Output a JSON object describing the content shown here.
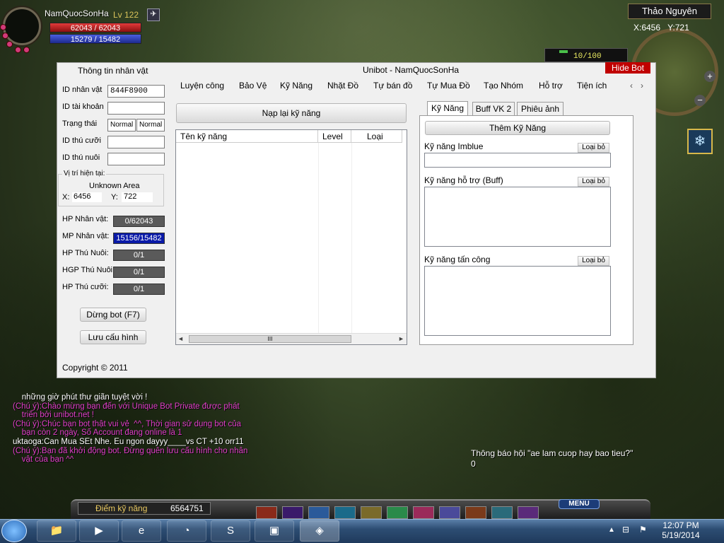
{
  "game": {
    "player_name": "NamQuocSonHa",
    "player_level": "Lv 122",
    "hp_text": "62043 / 62043",
    "mp_text": "15279 / 15482",
    "map_name": "Thảo Nguyên",
    "map_x": "X:6456",
    "map_y": "Y:721",
    "xp_text": "10/100",
    "skill_points_label": "Điểm kỹ năng",
    "skill_points_value": "6564751",
    "menu_label": "MENU",
    "notice_line1": "Thông báo hội \"ae lam cuop hay bao tieu?\"",
    "notice_line2": "0"
  },
  "chat": [
    {
      "text": "    những giờ phút thư giãn tuyệt vời !",
      "color": "#ffffff"
    },
    {
      "text": "(Chú ý):Chào mừng bạn đến với Unique Bot Private được phát",
      "color": "#e040c8"
    },
    {
      "text": "    triển bởi unibot.net !",
      "color": "#e040c8"
    },
    {
      "text": "(Chú ý):Chúc bạn bot thật vui vẻ  ^^, Thời gian sử dụng bot của",
      "color": "#e040c8"
    },
    {
      "text": "    bạn còn 2 ngày, Số Account đang online là 1",
      "color": "#e040c8"
    },
    {
      "text": "uktaoga:Can Mua SEt Nhe. Eu ngon dayyy____vs CT +10 orr11",
      "color": "#ffffff"
    },
    {
      "text": "(Chú ý):Bạn đã khởi động bot. Đừng quên lưu cấu hình cho nhân",
      "color": "#e040c8"
    },
    {
      "text": "    vật của bạn ^^",
      "color": "#e040c8"
    }
  ],
  "bot": {
    "window_title": "Unibot - NamQuocSonHa",
    "hide_button": "Hide Bot",
    "left_title": "Thông tin nhân vật",
    "fields": {
      "char_id_label": "ID nhân vật",
      "char_id_value": "844F8900",
      "account_id_label": "ID tài khoản",
      "account_id_value": "",
      "status_label": "Trạng thái",
      "status_value1": "Normal",
      "status_value2": "Normal",
      "mount_id_label": "ID thú cưỡi",
      "mount_id_value": "",
      "pet_id_label": "ID thú nuôi",
      "pet_id_value": ""
    },
    "position": {
      "legend": "Vị trí hiện tại:",
      "area": "Unknown Area",
      "x_label": "X:",
      "x_value": "6456",
      "y_label": "Y:",
      "y_value": "722"
    },
    "stats": [
      {
        "label": "HP Nhân vật:",
        "value": "0/62043",
        "color": "#5a5a5a"
      },
      {
        "label": "MP Nhân vật:",
        "value": "15156/15482",
        "color": "#0a1aa8"
      },
      {
        "label": "HP Thú Nuôi:",
        "value": "0/1",
        "color": "#5a5a5a"
      },
      {
        "label": "HGP Thú Nuôi:",
        "value": "0/1",
        "color": "#5a5a5a"
      },
      {
        "label": "HP Thú cưỡi:",
        "value": "0/1",
        "color": "#5a5a5a"
      }
    ],
    "stop_button": "Dừng bot (F7)",
    "save_button": "Lưu cấu hình",
    "copyright": "Copyright © 2011",
    "menu": [
      "Luyện công",
      "Bảo Vệ",
      "Kỹ Năng",
      "Nhặt Đồ",
      "Tự bán đồ",
      "Tự Mua Đồ",
      "Tạo Nhóm",
      "Hỗ trợ",
      "Tiện ích"
    ],
    "reload_button": "Nạp lại kỹ năng",
    "skill_columns": [
      "Tên kỹ năng",
      "Level",
      "Loại"
    ],
    "scroll_thumb": "III",
    "subtabs": [
      "Kỹ Năng",
      "Buff VK 2",
      "Phiêu ảnh"
    ],
    "add_skill_button": "Thêm Kỹ Năng",
    "imblue_label": "Kỹ năng Imblue",
    "buff_label": "Kỹ năng hỗ trợ (Buff)",
    "attack_label": "Kỹ năng tấn công",
    "remove_label": "Loại bỏ"
  },
  "taskbar": {
    "time": "12:07 PM",
    "date": "5/19/2014"
  }
}
